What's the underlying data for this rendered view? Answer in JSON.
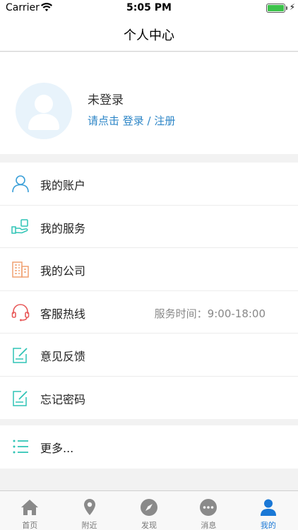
{
  "status_bar": {
    "carrier": "Carrier",
    "time": "5:05 PM"
  },
  "nav": {
    "title": "个人中心"
  },
  "profile": {
    "status": "未登录",
    "login_prompt": "请点击 登录 / 注册",
    "avatar_icon": "user-avatar-icon"
  },
  "menu": [
    {
      "label": "我的账户",
      "icon": "person-icon",
      "color": "#3a9fd8"
    },
    {
      "label": "我的服务",
      "icon": "service-hand-icon",
      "color": "#2fc4b5"
    },
    {
      "label": "我的公司",
      "icon": "building-icon",
      "color": "#f0a070"
    },
    {
      "label": "客服热线",
      "icon": "headset-icon",
      "color": "#e85a5a",
      "extra": "服务时间：9:00-18:00"
    },
    {
      "label": "意见反馈",
      "icon": "edit-note-icon",
      "color": "#2fc4b5"
    },
    {
      "label": "忘记密码",
      "icon": "edit-note-icon",
      "color": "#2fc4b5"
    }
  ],
  "more": {
    "label": "更多...",
    "icon": "list-icon",
    "color": "#2fc4b5"
  },
  "tabs": [
    {
      "label": "首页",
      "icon": "home-icon"
    },
    {
      "label": "附近",
      "icon": "location-pin-icon"
    },
    {
      "label": "发现",
      "icon": "compass-icon"
    },
    {
      "label": "消息",
      "icon": "chat-bubble-icon"
    },
    {
      "label": "我的",
      "icon": "person-icon",
      "active": true
    }
  ],
  "colors": {
    "accent": "#1a78d6",
    "link": "#2d86c7",
    "tab_inactive": "#8a8a8a"
  }
}
